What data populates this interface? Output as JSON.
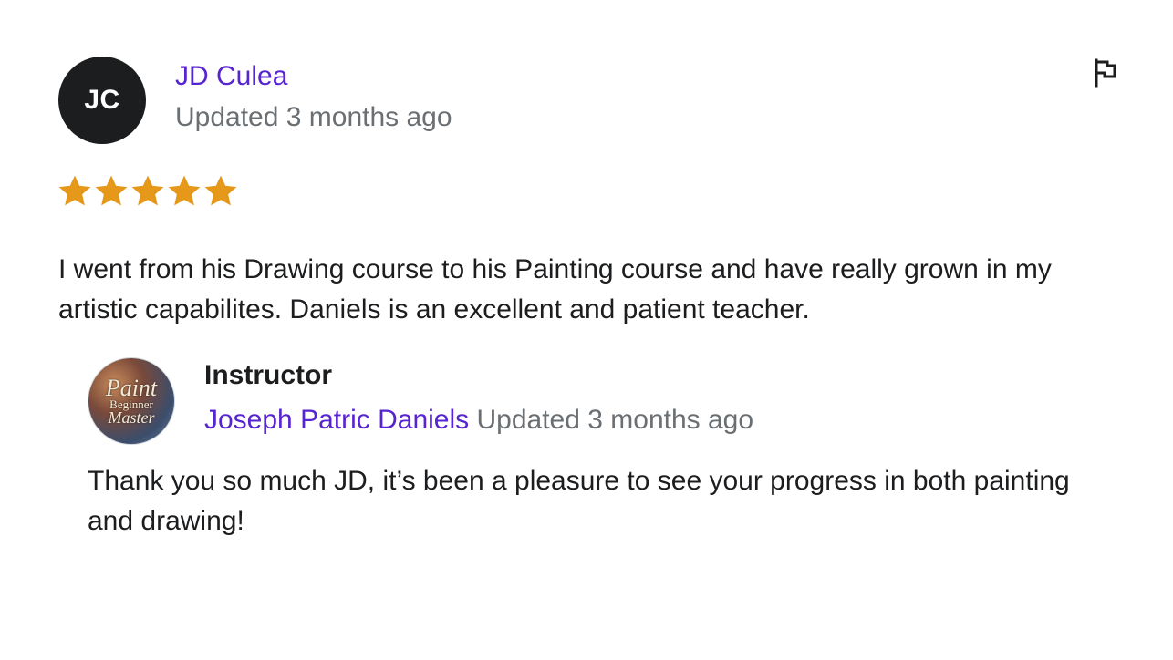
{
  "review": {
    "avatar_initials": "JC",
    "reviewer_name": "JD Culea",
    "updated": "Updated 3 months ago",
    "rating": 5,
    "rating_max": 5,
    "star_color": "#e59819",
    "star_icon": "star-icon",
    "flag_icon": "flag-icon",
    "comment": "I went from his Drawing course to his Painting course and have really grown in my artistic capabilites. Daniels is an excellent and patient teacher."
  },
  "response": {
    "avatar_logo_lines": [
      "Paint",
      "Beginner",
      "Master"
    ],
    "label": "Instructor",
    "instructor_name": "Joseph Patric Daniels",
    "updated": "Updated 3 months ago",
    "text": "Thank you so much JD, it’s been a pleasure to see your progress in both painting and drawing!"
  },
  "colors": {
    "link": "#5624d0",
    "muted": "#6a6f73",
    "text": "#1c1d1f",
    "avatar_bg": "#1c1d1f"
  }
}
